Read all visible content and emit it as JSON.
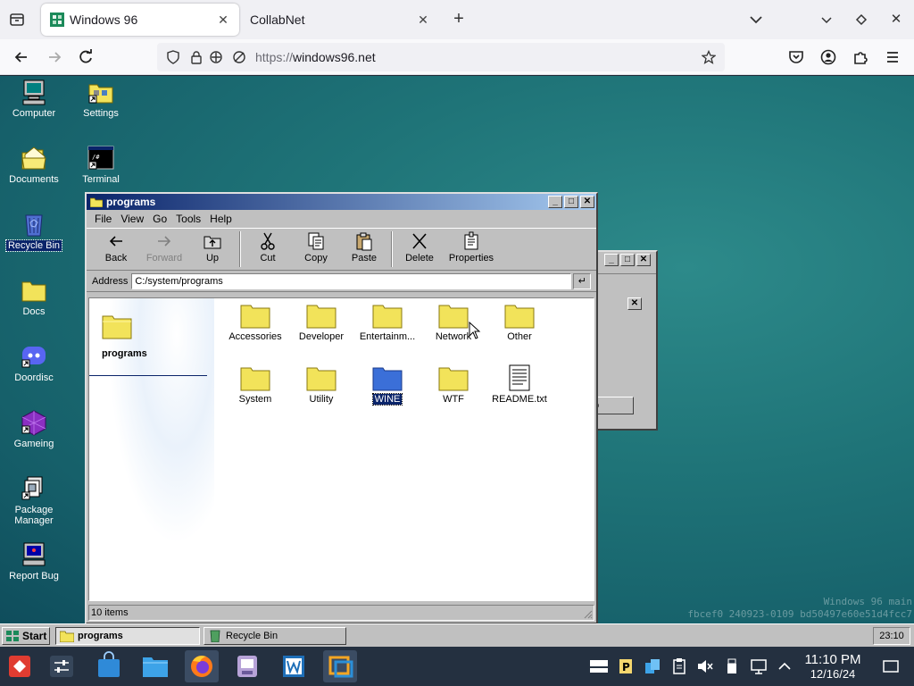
{
  "browser": {
    "tabs": [
      {
        "title": "Windows 96",
        "active": true
      },
      {
        "title": "CollabNet",
        "active": false
      }
    ],
    "url": {
      "scheme": "https://",
      "host": "windows96.net"
    }
  },
  "desktop": {
    "icons": [
      {
        "label": "Computer"
      },
      {
        "label": "Settings"
      },
      {
        "label": "Documents"
      },
      {
        "label": "Terminal"
      },
      {
        "label": "Recycle Bin",
        "selected": true
      },
      {
        "label": "Docs"
      },
      {
        "label": "Doordisc"
      },
      {
        "label": "Gameing"
      },
      {
        "label": "Package Manager"
      },
      {
        "label": "Report Bug"
      }
    ],
    "watermark": {
      "line1": "Windows 96 main",
      "line2": "fbcef0 240923-0109 bd50497e60e51d4fcc7"
    }
  },
  "explorer": {
    "title": "programs",
    "menu": [
      "File",
      "View",
      "Go",
      "Tools",
      "Help"
    ],
    "toolbar": [
      {
        "label": "Back",
        "icon": "back-arrow-icon",
        "disabled": false
      },
      {
        "label": "Forward",
        "icon": "forward-arrow-icon",
        "disabled": true
      },
      {
        "label": "Up",
        "icon": "up-folder-icon",
        "disabled": false
      },
      {
        "label": "Cut",
        "icon": "scissors-icon",
        "disabled": false
      },
      {
        "label": "Copy",
        "icon": "copy-icon",
        "disabled": false
      },
      {
        "label": "Paste",
        "icon": "paste-icon",
        "disabled": false
      },
      {
        "label": "Delete",
        "icon": "delete-x-icon",
        "disabled": false
      },
      {
        "label": "Properties",
        "icon": "properties-icon",
        "disabled": false
      }
    ],
    "address": {
      "label": "Address",
      "value": "C:/system/programs",
      "go": "↵"
    },
    "sidebar_title": "programs",
    "items": [
      {
        "label": "Accessories",
        "type": "folder"
      },
      {
        "label": "Developer",
        "type": "folder"
      },
      {
        "label": "Entertainm...",
        "type": "folder"
      },
      {
        "label": "Network",
        "type": "folder"
      },
      {
        "label": "Other",
        "type": "folder"
      },
      {
        "label": "System",
        "type": "folder"
      },
      {
        "label": "Utility",
        "type": "folder"
      },
      {
        "label": "WINE",
        "type": "folder-blue",
        "selected": true
      },
      {
        "label": "WTF",
        "type": "folder"
      },
      {
        "label": "README.txt",
        "type": "text-file"
      }
    ],
    "status": "10 items"
  },
  "bg_window": {
    "button_label": "o"
  },
  "w96_taskbar": {
    "start": "Start",
    "tasks": [
      {
        "label": "programs",
        "active": true
      },
      {
        "label": "Recycle Bin",
        "active": false
      }
    ],
    "clock": "23:10"
  },
  "host_panel": {
    "time": "11:10 PM",
    "date": "12/16/24"
  },
  "colors": {
    "titlebar": "#0a246a",
    "selection": "#0a246a",
    "folder_yellow": "#f2e35a",
    "folder_blue": "#3b6fd8",
    "desktop": "#1f7478"
  }
}
